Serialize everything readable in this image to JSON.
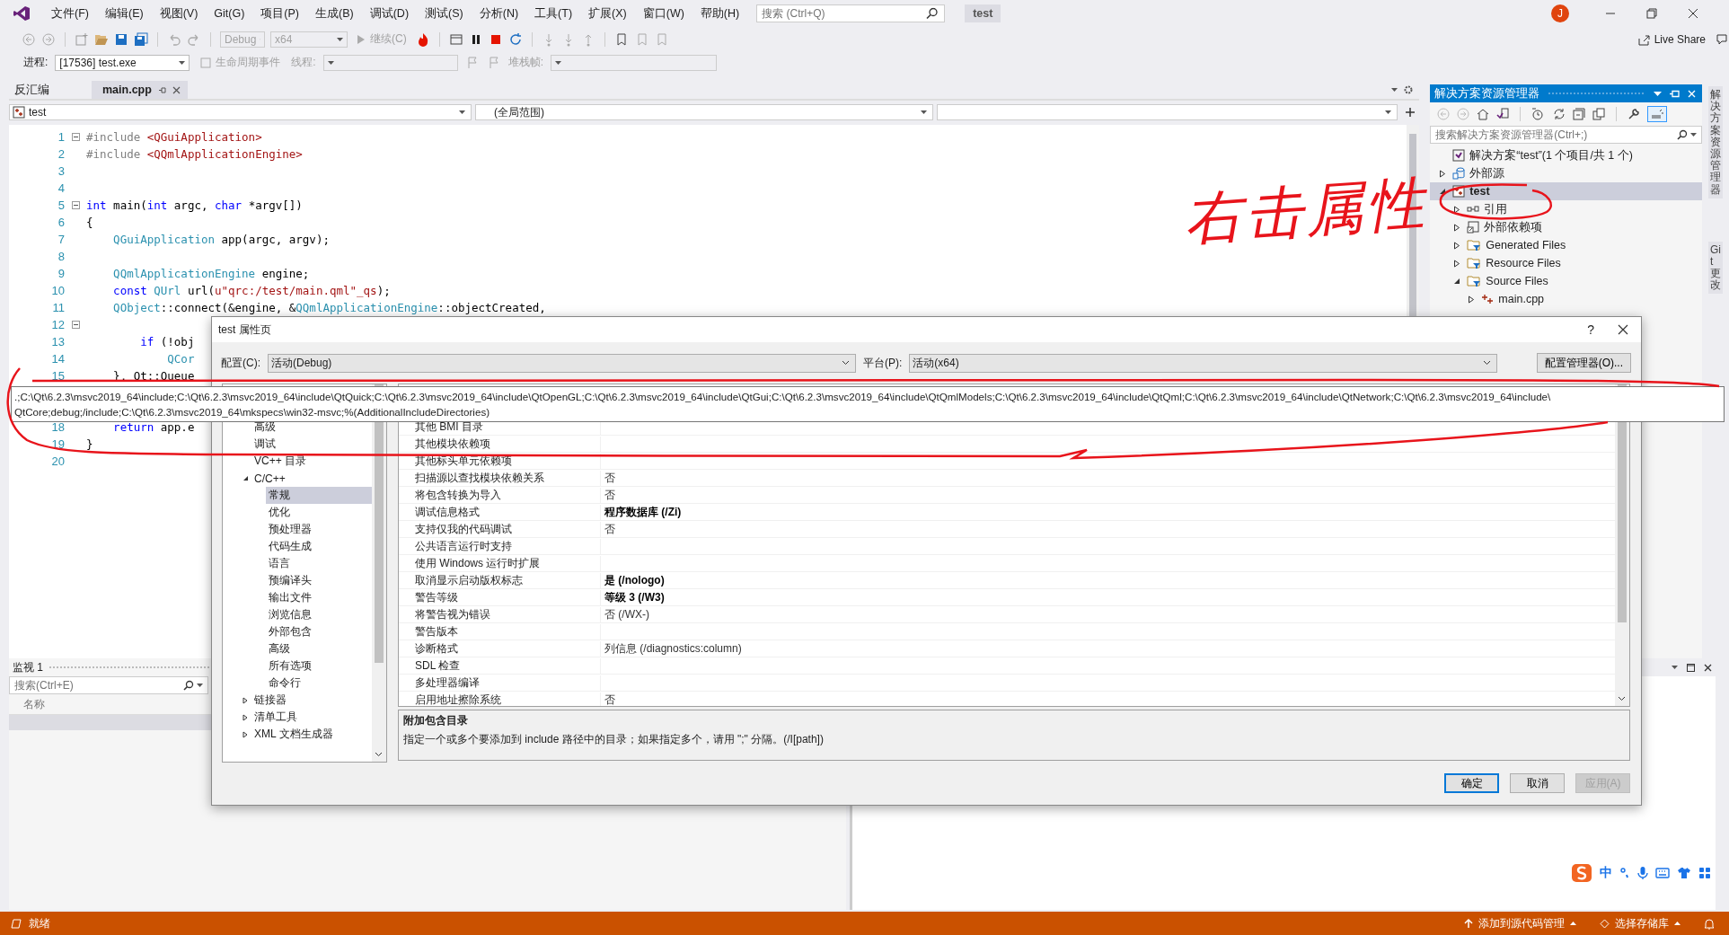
{
  "menu": [
    "文件(F)",
    "编辑(E)",
    "视图(V)",
    "Git(G)",
    "项目(P)",
    "生成(B)",
    "调试(D)",
    "测试(S)",
    "分析(N)",
    "工具(T)",
    "扩展(X)",
    "窗口(W)",
    "帮助(H)"
  ],
  "search": {
    "placeholder": "搜索 (Ctrl+Q)"
  },
  "title": "test",
  "user": {
    "initial": "J"
  },
  "toolbar": {
    "configuration": "Debug",
    "platform": "x64",
    "continue": "继续(C)",
    "live_share": "Live Share"
  },
  "debug_toolbar": {
    "process_label": "进程:",
    "process": "[17536] test.exe",
    "lifecycle": "生命周期事件",
    "thread_label": "线程:",
    "stack_label": "堆栈帧:"
  },
  "editor": {
    "tabs": [
      {
        "label": "反汇编",
        "selected": false
      },
      {
        "label": "main.cpp",
        "selected": true
      }
    ],
    "nav": {
      "project": "test",
      "scope": "(全局范围)"
    },
    "lines": [
      {
        "number": "1",
        "fold": true,
        "tokens": [
          {
            "kind": "directive",
            "text": "#include "
          },
          {
            "kind": "string",
            "text": "<QGuiApplication>"
          }
        ]
      },
      {
        "number": "2",
        "fold": false,
        "tokens": [
          {
            "kind": "directive",
            "text": "#include "
          },
          {
            "kind": "string",
            "text": "<QQmlApplicationEngine>"
          }
        ]
      },
      {
        "number": "3",
        "fold": false
      },
      {
        "number": "4",
        "fold": false
      },
      {
        "number": "5",
        "fold": true,
        "tokens": [
          {
            "kind": "keyword",
            "text": "int"
          },
          {
            "kind": "plain",
            "text": " main("
          },
          {
            "kind": "keyword",
            "text": "int"
          },
          {
            "kind": "plain",
            "text": " argc, "
          },
          {
            "kind": "keyword",
            "text": "char"
          },
          {
            "kind": "plain",
            "text": " *argv[])"
          }
        ]
      },
      {
        "number": "6",
        "fold": false,
        "tokens": [
          {
            "kind": "plain",
            "text": "{"
          }
        ]
      },
      {
        "number": "7",
        "fold": false,
        "tokens": [
          {
            "kind": "type",
            "text": "    QGuiApplication"
          },
          {
            "kind": "plain",
            "text": " app(argc, argv);"
          }
        ]
      },
      {
        "number": "8",
        "fold": false
      },
      {
        "number": "9",
        "fold": false,
        "tokens": [
          {
            "kind": "type",
            "text": "    QQmlApplicationEngine"
          },
          {
            "kind": "plain",
            "text": " engine;"
          }
        ]
      },
      {
        "number": "10",
        "fold": false,
        "tokens": [
          {
            "kind": "keyword",
            "text": "    const"
          },
          {
            "kind": "type",
            "text": " QUrl"
          },
          {
            "kind": "plain",
            "text": " url("
          },
          {
            "kind": "string",
            "text": "u\"qrc:/test/main.qml\"_qs"
          },
          {
            "kind": "plain",
            "text": ");"
          }
        ]
      },
      {
        "number": "11",
        "fold": false,
        "tokens": [
          {
            "kind": "type",
            "text": "    QObject"
          },
          {
            "kind": "plain",
            "text": "::connect(&engine, &"
          },
          {
            "kind": "type",
            "text": "QQmlApplicationEngine"
          },
          {
            "kind": "plain",
            "text": "::objectCreated,"
          }
        ]
      },
      {
        "number": "12",
        "fold": true
      },
      {
        "number": "13",
        "fold": false,
        "tokens": [
          {
            "kind": "keyword",
            "text": "        if"
          },
          {
            "kind": "plain",
            "text": " (!obj"
          }
        ]
      },
      {
        "number": "14",
        "fold": false,
        "tokens": [
          {
            "kind": "type",
            "text": "            QCor"
          }
        ]
      },
      {
        "number": "15",
        "fold": false,
        "tokens": [
          {
            "kind": "plain",
            "text": "    }, Qt::Queue"
          }
        ]
      },
      {
        "number": "18",
        "fold": false,
        "tokens": [
          {
            "kind": "keyword",
            "text": "    return"
          },
          {
            "kind": "plain",
            "text": " app.e"
          }
        ]
      },
      {
        "number": "19",
        "fold": false,
        "tokens": [
          {
            "kind": "plain",
            "text": "}"
          }
        ]
      },
      {
        "number": "20",
        "fold": false
      }
    ]
  },
  "solution_explorer": {
    "title": "解决方案资源管理器",
    "search": {
      "placeholder": "搜索解决方案资源管理器(Ctrl+;)"
    },
    "tree": [
      {
        "label": "解决方案“test”(1 个项目/共 1 个)",
        "kind": "solution",
        "selected": false,
        "children": [
          {
            "label": "外部源",
            "kind": "external",
            "expanded": false,
            "selected": false
          },
          {
            "label": "test",
            "kind": "project",
            "expanded": true,
            "selected": true,
            "children": [
              {
                "label": "引用",
                "kind": "references",
                "expanded": false,
                "selected": false
              },
              {
                "label": "外部依赖项",
                "kind": "dependencies",
                "expanded": false,
                "selected": false
              },
              {
                "label": "Generated Files",
                "kind": "filter",
                "expanded": false,
                "selected": false
              },
              {
                "label": "Resource Files",
                "kind": "filter",
                "expanded": false,
                "selected": false
              },
              {
                "label": "Source Files",
                "kind": "filter",
                "expanded": true,
                "selected": false,
                "children": [
                  {
                    "label": "main.cpp",
                    "kind": "cpp",
                    "expanded": false,
                    "selected": false
                  }
                ]
              }
            ]
          }
        ]
      }
    ]
  },
  "side_tabs": [
    "解决方案资源管理器",
    "Git 更改"
  ],
  "watch": {
    "title": "监视 1",
    "search": {
      "placeholder": "搜索(Ctrl+E)"
    },
    "column": "名称"
  },
  "dialog": {
    "title": "test 属性页",
    "help": "?",
    "config_label": "配置(C):",
    "config": "活动(Debug)",
    "platform_label": "平台(P):",
    "platform": "活动(x64)",
    "manager_button": "配置管理器(O)...",
    "tree": [
      {
        "label": "高级",
        "selected": false
      },
      {
        "label": "调试",
        "selected": false
      },
      {
        "label": "VC++ 目录",
        "selected": false
      },
      {
        "label": "C/C++",
        "expanded": true,
        "selected": false,
        "children": [
          {
            "label": "常规",
            "selected": true
          },
          {
            "label": "优化",
            "selected": false
          },
          {
            "label": "预处理器",
            "selected": false
          },
          {
            "label": "代码生成",
            "selected": false
          },
          {
            "label": "语言",
            "selected": false
          },
          {
            "label": "预编译头",
            "selected": false
          },
          {
            "label": "输出文件",
            "selected": false
          },
          {
            "label": "浏览信息",
            "selected": false
          },
          {
            "label": "外部包含",
            "selected": false
          },
          {
            "label": "高级",
            "selected": false
          },
          {
            "label": "所有选项",
            "selected": false
          },
          {
            "label": "命令行",
            "selected": false
          }
        ]
      },
      {
        "label": "链接器",
        "expanded": false,
        "selected": false
      },
      {
        "label": "清单工具",
        "expanded": false,
        "selected": false
      },
      {
        "label": "XML 文档生成器",
        "expanded": false,
        "selected": false
      }
    ],
    "properties": [
      {
        "name": "其他 BMI 目录"
      },
      {
        "name": "其他模块依赖项"
      },
      {
        "name": "其他标头单元依赖项"
      },
      {
        "name": "扫描源以查找模块依赖关系",
        "value": "否",
        "modified": false
      },
      {
        "name": "将包含转换为导入",
        "value": "否",
        "modified": false
      },
      {
        "name": "调试信息格式",
        "value": "程序数据库 (/Zi)",
        "modified": true
      },
      {
        "name": "支持仅我的代码调试",
        "value": "否",
        "modified": false
      },
      {
        "name": "公共语言运行时支持"
      },
      {
        "name": "使用 Windows 运行时扩展"
      },
      {
        "name": "取消显示启动版权标志",
        "value": "是 (/nologo)",
        "modified": true
      },
      {
        "name": "警告等级",
        "value": "等级 3 (/W3)",
        "modified": true
      },
      {
        "name": "将警告视为错误",
        "value": "否 (/WX-)",
        "modified": false
      },
      {
        "name": "警告版本"
      },
      {
        "name": "诊断格式",
        "value": "列信息 (/diagnostics:column)",
        "modified": false
      },
      {
        "name": "SDL 检查"
      },
      {
        "name": "多处理器编译"
      },
      {
        "name": "启用地址擦除系统",
        "value": "否",
        "modified": false
      }
    ],
    "description": {
      "title": "附加包含目录",
      "text": "指定一个或多个要添加到 include 路径中的目录；如果指定多个，请用 \";\" 分隔。(/I[path])"
    },
    "buttons": [
      {
        "label": "确定",
        "kind": "default",
        "disabled": false
      },
      {
        "label": "取消",
        "kind": "normal",
        "disabled": false
      },
      {
        "label": "应用(A)",
        "kind": "normal",
        "disabled": true
      }
    ]
  },
  "tooltip": {
    "lines": [
      ".;C:\\Qt\\6.2.3\\msvc2019_64\\include;C:\\Qt\\6.2.3\\msvc2019_64\\include\\QtQuick;C:\\Qt\\6.2.3\\msvc2019_64\\include\\QtOpenGL;C:\\Qt\\6.2.3\\msvc2019_64\\include\\QtGui;C:\\Qt\\6.2.3\\msvc2019_64\\include\\QtQmlModels;C:\\Qt\\6.2.3\\msvc2019_64\\include\\QtQml;C:\\Qt\\6.2.3\\msvc2019_64\\include\\QtNetwork;C:\\Qt\\6.2.3\\msvc2019_64\\include\\",
      "QtCore;debug;/include;C:\\Qt\\6.2.3\\msvc2019_64\\mkspecs\\win32-msvc;%(AdditionalIncludeDirectories)"
    ]
  },
  "annotation": {
    "text": "右击属性"
  },
  "ime": {
    "mode": "中"
  },
  "status_bar": {
    "status": "就绪",
    "source_control": "添加到源代码管理",
    "repository": "选择存储库"
  }
}
